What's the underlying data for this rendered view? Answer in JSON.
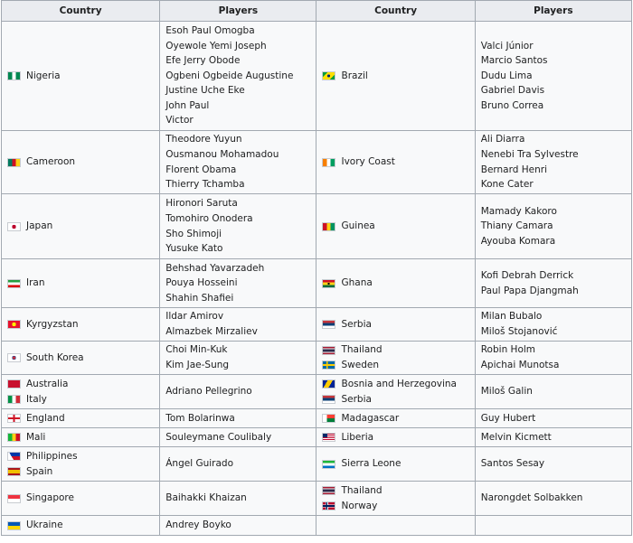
{
  "headers": [
    "Country",
    "Players",
    "Country",
    "Players"
  ],
  "rows": [
    {
      "left": [
        {
          "name": "Nigeria",
          "flag": "nigeria-flag-icon"
        }
      ],
      "left_players": [
        "Esoh Paul Omogba",
        "Oyewole Yemi Joseph",
        "Efe Jerry Obode",
        "Ogbeni Ogbeide Augustine",
        "Justine Uche Eke",
        "John Paul",
        "Victor"
      ],
      "right": [
        {
          "name": "Brazil",
          "flag": "brazil-flag-icon"
        }
      ],
      "right_players": [
        "Valci Júnior",
        "Marcio Santos",
        "Dudu Lima",
        "Gabriel Davis",
        "Bruno Correa"
      ]
    },
    {
      "left": [
        {
          "name": "Cameroon",
          "flag": "cameroon-flag-icon"
        }
      ],
      "left_players": [
        "Theodore Yuyun",
        "Ousmanou Mohamadou",
        "Florent Obama",
        "Thierry Tchamba"
      ],
      "right": [
        {
          "name": "Ivory Coast",
          "flag": "ivory-coast-flag-icon"
        }
      ],
      "right_players": [
        "Ali Diarra",
        "Nenebi Tra Sylvestre",
        "Bernard Henri",
        "Kone Cater"
      ]
    },
    {
      "left": [
        {
          "name": "Japan",
          "flag": "japan-flag-icon"
        }
      ],
      "left_players": [
        "Hironori Saruta",
        "Tomohiro Onodera",
        "Sho Shimoji",
        "Yusuke Kato"
      ],
      "right": [
        {
          "name": "Guinea",
          "flag": "guinea-flag-icon"
        }
      ],
      "right_players": [
        "Mamady Kakoro",
        "Thiany Camara",
        "Ayouba Komara"
      ]
    },
    {
      "left": [
        {
          "name": "Iran",
          "flag": "iran-flag-icon"
        }
      ],
      "left_players": [
        "Behshad Yavarzadeh",
        "Pouya Hosseini",
        "Shahin Shafiei"
      ],
      "right": [
        {
          "name": "Ghana",
          "flag": "ghana-flag-icon"
        }
      ],
      "right_players": [
        "Kofi Debrah Derrick",
        "Paul Papa Djangmah"
      ]
    },
    {
      "left": [
        {
          "name": "Kyrgyzstan",
          "flag": "kyrgyzstan-flag-icon"
        }
      ],
      "left_players": [
        "Ildar Amirov",
        "Almazbek Mirzaliev"
      ],
      "right": [
        {
          "name": "Serbia",
          "flag": "serbia-flag-icon"
        }
      ],
      "right_players": [
        "Milan Bubalo",
        "Miloš Stojanović"
      ]
    },
    {
      "left": [
        {
          "name": "South Korea",
          "flag": "south-korea-flag-icon"
        }
      ],
      "left_players": [
        "Choi Min-Kuk",
        "Kim Jae-Sung"
      ],
      "right": [
        {
          "name": "Thailand",
          "flag": "thailand-flag-icon"
        },
        {
          "name": "Sweden",
          "flag": "sweden-flag-icon"
        }
      ],
      "right_players": [
        "Robin Holm",
        "Apichai Munotsa"
      ]
    },
    {
      "left": [
        {
          "name": "Australia",
          "flag": "australia-flag-icon"
        },
        {
          "name": "Italy",
          "flag": "italy-flag-icon"
        }
      ],
      "left_players": [
        "Adriano Pellegrino"
      ],
      "right": [
        {
          "name": "Bosnia and Herzegovina",
          "flag": "bosnia-flag-icon"
        },
        {
          "name": "Serbia",
          "flag": "serbia-flag-icon"
        }
      ],
      "right_players": [
        "Miloš Galin"
      ]
    },
    {
      "left": [
        {
          "name": "England",
          "flag": "england-flag-icon"
        }
      ],
      "left_players": [
        "Tom Bolarinwa"
      ],
      "right": [
        {
          "name": "Madagascar",
          "flag": "madagascar-flag-icon"
        }
      ],
      "right_players": [
        "Guy Hubert"
      ]
    },
    {
      "left": [
        {
          "name": "Mali",
          "flag": "mali-flag-icon"
        }
      ],
      "left_players": [
        "Souleymane Coulibaly"
      ],
      "right": [
        {
          "name": "Liberia",
          "flag": "liberia-flag-icon"
        }
      ],
      "right_players": [
        "Melvin Kicmett"
      ]
    },
    {
      "left": [
        {
          "name": "Philippines",
          "flag": "philippines-flag-icon"
        },
        {
          "name": "Spain",
          "flag": "spain-flag-icon"
        }
      ],
      "left_players": [
        "Ángel Guirado"
      ],
      "right": [
        {
          "name": "Sierra Leone",
          "flag": "sierra-leone-flag-icon"
        }
      ],
      "right_players": [
        "Santos Sesay"
      ]
    },
    {
      "left": [
        {
          "name": "Singapore",
          "flag": "singapore-flag-icon"
        }
      ],
      "left_players": [
        "Baihakki Khaizan"
      ],
      "right": [
        {
          "name": "Thailand",
          "flag": "thailand-flag-icon"
        },
        {
          "name": "Norway",
          "flag": "norway-flag-icon"
        }
      ],
      "right_players": [
        "Narongdet Solbakken"
      ]
    },
    {
      "left": [
        {
          "name": "Ukraine",
          "flag": "ukraine-flag-icon"
        }
      ],
      "left_players": [
        "Andrey Boyko"
      ],
      "right": [],
      "right_players": []
    }
  ]
}
